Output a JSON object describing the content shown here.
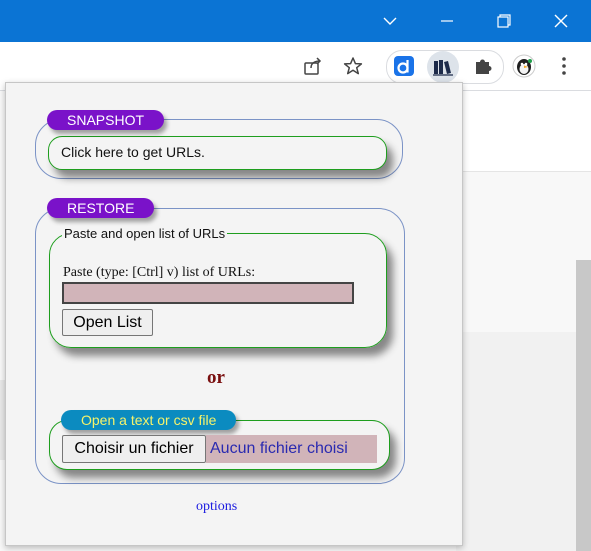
{
  "browser": {
    "window_controls": [
      "chevron-down-icon",
      "minimize-icon",
      "restore-icon",
      "close-icon"
    ],
    "toolbar_icons": [
      "share-icon",
      "star-icon",
      "extension-d-icon",
      "books-icon",
      "puzzle-icon",
      "profile-icon",
      "kebab-menu-icon"
    ],
    "accent": "#0b74d4"
  },
  "popup": {
    "snapshot": {
      "label": "SNAPSHOT",
      "action_text": "Click here to get URLs."
    },
    "restore": {
      "label": "RESTORE",
      "legend": "Paste and open list of URLs",
      "instruction": "Paste (type: [Ctrl] v) list of URLs:",
      "input_value": "",
      "open_button": "Open List"
    },
    "or_text": "or",
    "file": {
      "label": "Open a text or csv file",
      "choose_button": "Choisir un fichier",
      "no_file_text": "Aucun fichier choisi"
    },
    "options_link": "options",
    "colors": {
      "pill_purple": "#7a12c9",
      "pill_teal": "#0b8bc0",
      "pill_teal_text": "#f6f36a",
      "border_green": "#1e9e1e",
      "input_bg": "#d1b4b9",
      "or_color": "#7a1010"
    }
  }
}
